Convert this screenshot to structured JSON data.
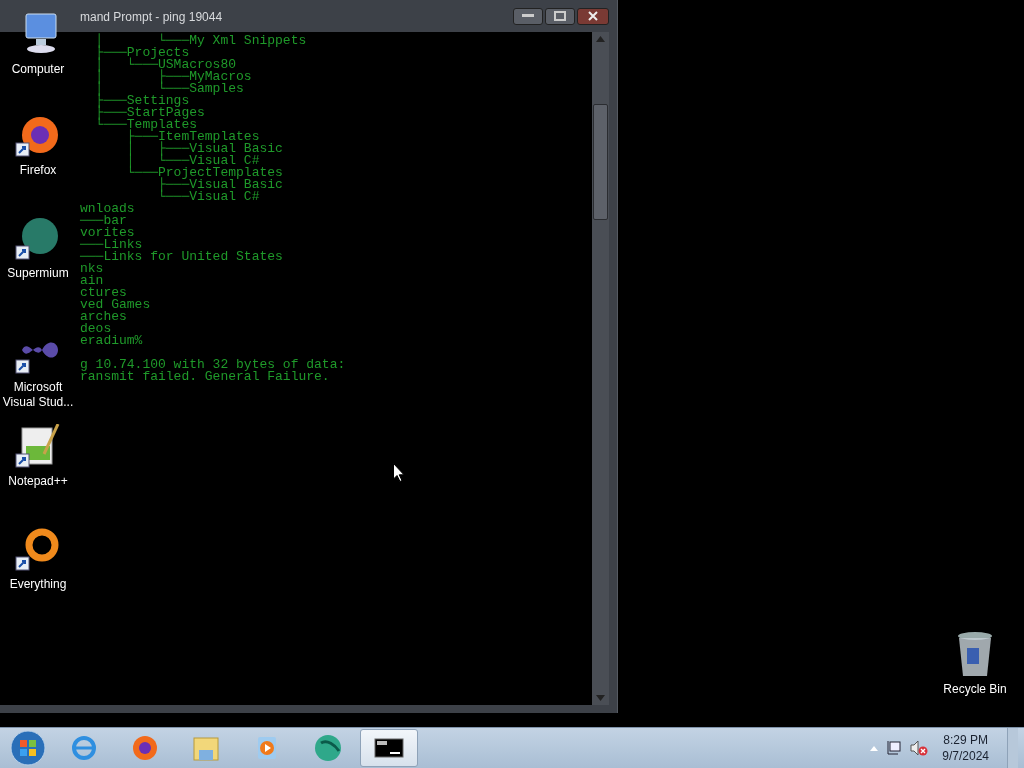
{
  "window": {
    "title": "mand Prompt - ping  19044",
    "lines": [
      "  │       └───My Xml Snippets",
      "  ├───Projects",
      "  │   └───USMacros80",
      "  │       ├───MyMacros",
      "  │       └───Samples",
      "  ├───Settings",
      "  ├───StartPages",
      "  └───Templates",
      "      ├───ItemTemplates",
      "      │   ├───Visual Basic",
      "      │   └───Visual C#",
      "      └───ProjectTemplates",
      "          ├───Visual Basic",
      "          └───Visual C#",
      "wnloads",
      "───bar",
      "vorites",
      "───Links",
      "───Links for United States",
      "nks",
      "ain",
      "ctures",
      "ved Games",
      "arches",
      "deos",
      "eradium%"
    ],
    "ping_lines": [
      "g 10.74.100 with 32 bytes of data:",
      "ransmit failed. General Failure."
    ]
  },
  "desktop_icons": [
    {
      "kind": "computer",
      "label": "Computer"
    },
    {
      "kind": "firefox",
      "label": "Firefox"
    },
    {
      "kind": "supermium",
      "label": "Supermium"
    },
    {
      "kind": "visualstudio",
      "label": "Microsoft Visual Stud..."
    },
    {
      "kind": "notepad",
      "label": "Notepad++"
    },
    {
      "kind": "everything",
      "label": "Everything"
    }
  ],
  "recycle_bin": {
    "label": "Recycle Bin"
  },
  "taskbar": {
    "items": [
      {
        "kind": "ie",
        "selected": false
      },
      {
        "kind": "firefox",
        "selected": false
      },
      {
        "kind": "explorer",
        "selected": false
      },
      {
        "kind": "media",
        "selected": false
      },
      {
        "kind": "supermium",
        "selected": false
      },
      {
        "kind": "cmd",
        "selected": true
      }
    ]
  },
  "clock": {
    "time": "8:29 PM",
    "date": "9/7/2024"
  }
}
